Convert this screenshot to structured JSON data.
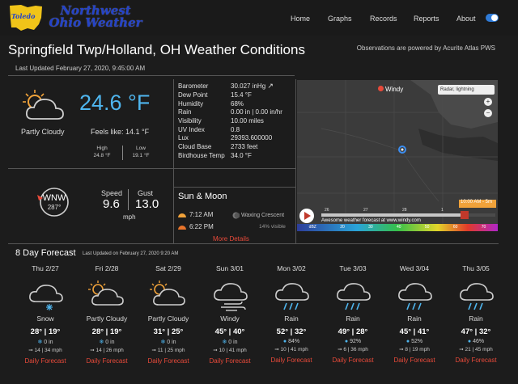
{
  "nav": {
    "site_name": "Northwest Ohio Weather",
    "logo_text": "Toledo",
    "links": [
      "Home",
      "Graphs",
      "Records",
      "Reports",
      "About"
    ]
  },
  "header": {
    "title": "Springfield Twp/Holland, OH Weather Conditions",
    "last_updated": "Last Updated February 27, 2020, 9:45:00 AM",
    "powered_by": "Observations are powered by Acurite Atlas PWS"
  },
  "current": {
    "temperature": "24.6 °F",
    "condition": "Partly Cloudy",
    "feels_like": "Feels like: 14.1 °F",
    "high_label": "High",
    "high_value": "24.8 °F",
    "low_label": "Low",
    "low_value": "19.1 °F"
  },
  "wind": {
    "direction": "WNW",
    "degrees": "287°",
    "speed_label": "Speed",
    "speed_value": "9.6",
    "gust_label": "Gust",
    "gust_value": "13.0",
    "unit": "mph"
  },
  "observations": [
    {
      "label": "Barometer",
      "value": "30.027 inHg"
    },
    {
      "label": "Dew Point",
      "value": "15.4 °F"
    },
    {
      "label": "Humidity",
      "value": "68%"
    },
    {
      "label": "Rain",
      "value": "0.00 in | 0.00 in/hr"
    },
    {
      "label": "Visibility",
      "value": "10.00 miles"
    },
    {
      "label": "UV Index",
      "value": "0.8"
    },
    {
      "label": "Lux",
      "value": "29393.600000"
    },
    {
      "label": "Cloud Base",
      "value": "2733 feet"
    },
    {
      "label": "Birdhouse Temp",
      "value": "34.0 °F"
    }
  ],
  "sun_moon": {
    "title": "Sun & Moon",
    "sunrise": "7:12 AM",
    "sunset": "6:22 PM",
    "moon_phase": "Waxing Crescent",
    "moon_visible": "14% visible",
    "more": "More Details"
  },
  "map": {
    "brand": "Windy",
    "layer": "Radar, lightning",
    "time": "10:00 AM - 5m",
    "footer": "Awesome weather forecast at www.windy.com",
    "day_labels": [
      "26",
      "27",
      "28",
      "1"
    ],
    "legend_labels": [
      "dBZ",
      "20",
      "30",
      "40",
      "50",
      "60",
      "70"
    ]
  },
  "forecast": {
    "title": "8 Day Forecast",
    "updated": "Last Updated on February 27, 2020 9:20 AM",
    "link_label": "Daily Forecast",
    "days": [
      {
        "day": "Thu 2/27",
        "condition": "Snow",
        "high": "28°",
        "low": "19°",
        "precip": "0 in",
        "wind": "14 | 34 mph",
        "icon": "snow-icon"
      },
      {
        "day": "Fri 2/28",
        "condition": "Partly Cloudy",
        "high": "28°",
        "low": "19°",
        "precip": "0 in",
        "wind": "14 | 26 mph",
        "icon": "partly-cloudy-icon"
      },
      {
        "day": "Sat 2/29",
        "condition": "Partly Cloudy",
        "high": "31°",
        "low": "25°",
        "precip": "0 in",
        "wind": "11 | 25 mph",
        "icon": "partly-cloudy-icon"
      },
      {
        "day": "Sun 3/01",
        "condition": "Windy",
        "high": "45°",
        "low": "40°",
        "precip": "0 in",
        "wind": "10 | 41 mph",
        "icon": "windy-icon"
      },
      {
        "day": "Mon 3/02",
        "condition": "Rain",
        "high": "52°",
        "low": "32°",
        "precip": "84%",
        "wind": "10 | 41 mph",
        "icon": "rain-icon"
      },
      {
        "day": "Tue 3/03",
        "condition": "Rain",
        "high": "49°",
        "low": "28°",
        "precip": "92%",
        "wind": "6 | 36 mph",
        "icon": "rain-icon"
      },
      {
        "day": "Wed 3/04",
        "condition": "Rain",
        "high": "45°",
        "low": "41°",
        "precip": "52%",
        "wind": "8 | 19 mph",
        "icon": "rain-icon"
      },
      {
        "day": "Thu 3/05",
        "condition": "Rain",
        "high": "47°",
        "low": "32°",
        "precip": "46%",
        "wind": "21 | 45 mph",
        "icon": "rain-icon"
      }
    ]
  },
  "colors": {
    "accent": "#4fb6ef",
    "link": "#e84a3a",
    "logo": "#f0c419",
    "brand": "#2343c9"
  }
}
